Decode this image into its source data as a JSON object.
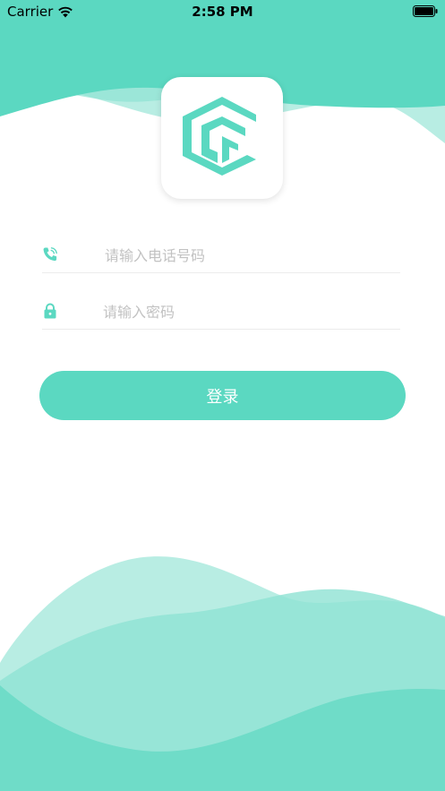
{
  "status_bar": {
    "carrier": "Carrier",
    "time": "2:58 PM"
  },
  "login": {
    "phone_placeholder": "请输入电话号码",
    "password_placeholder": "请输入密码",
    "submit_label": "登录"
  },
  "icons": {
    "phone": "phone-icon",
    "lock": "lock-icon",
    "wifi": "wifi-icon",
    "battery": "battery-icon",
    "logo": "app-logo-icon"
  },
  "colors": {
    "accent": "#5bd8c1",
    "wave_light": "#b8ede3",
    "placeholder": "#c2c2c2"
  }
}
